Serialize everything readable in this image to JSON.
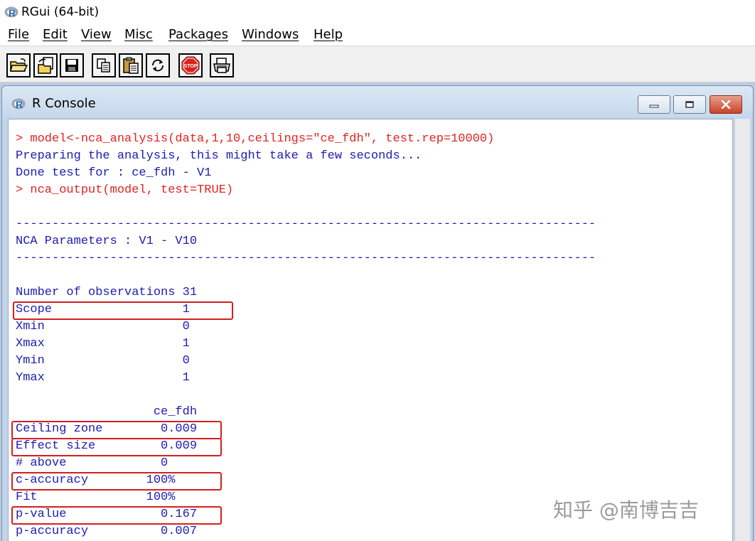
{
  "app": {
    "title": "RGui (64-bit)"
  },
  "menu": [
    {
      "label": "File"
    },
    {
      "label": "Edit"
    },
    {
      "label": "View"
    },
    {
      "label": "Misc"
    },
    {
      "label": "Packages"
    },
    {
      "label": "Windows"
    },
    {
      "label": "Help"
    }
  ],
  "toolbar": {
    "buttons": [
      {
        "icon": "open-folder-icon"
      },
      {
        "icon": "load-workspace-icon"
      },
      {
        "icon": "save-icon"
      },
      {
        "icon": "copy-icon"
      },
      {
        "icon": "paste-icon"
      },
      {
        "icon": "refresh-icon"
      },
      {
        "icon": "stop-icon",
        "label": "STOP",
        "color": "#d8241c"
      },
      {
        "icon": "print-icon"
      }
    ]
  },
  "console": {
    "title": "R Console",
    "lines": [
      {
        "text": "> model<-nca_analysis(data,1,10,ceilings=\"ce_fdh\", test.rep=10000)",
        "kind": "input"
      },
      {
        "text": "Preparing the analysis, this might take a few seconds...",
        "kind": "output"
      },
      {
        "text": "Done test for : ce_fdh - V1",
        "kind": "output"
      },
      {
        "text": "> nca_output(model, test=TRUE)",
        "kind": "input"
      },
      {
        "text": "",
        "kind": "output"
      },
      {
        "text": "--------------------------------------------------------------------------------",
        "kind": "output"
      },
      {
        "text": "NCA Parameters : V1 - V10",
        "kind": "output"
      },
      {
        "text": "--------------------------------------------------------------------------------",
        "kind": "output"
      },
      {
        "text": "",
        "kind": "output"
      },
      {
        "text": "Number of observations 31",
        "kind": "output"
      },
      {
        "text": "Scope                  1",
        "kind": "output"
      },
      {
        "text": "Xmin                   0",
        "kind": "output"
      },
      {
        "text": "Xmax                   1",
        "kind": "output"
      },
      {
        "text": "Ymin                   0",
        "kind": "output"
      },
      {
        "text": "Ymax                   1",
        "kind": "output"
      },
      {
        "text": "",
        "kind": "output"
      },
      {
        "text": "                   ce_fdh",
        "kind": "output"
      },
      {
        "text": "Ceiling zone        0.009",
        "kind": "output"
      },
      {
        "text": "Effect size         0.009",
        "kind": "output"
      },
      {
        "text": "# above             0",
        "kind": "output"
      },
      {
        "text": "c-accuracy        100%",
        "kind": "output"
      },
      {
        "text": "Fit               100%",
        "kind": "output"
      },
      {
        "text": "p-value             0.167",
        "kind": "output"
      },
      {
        "text": "p-accuracy          0.007",
        "kind": "output"
      }
    ]
  },
  "watermark": "知乎 @南博吉吉",
  "colors": {
    "input": "#e1241f",
    "output": "#1c1cb4",
    "highlight": "#d41f1f",
    "mdi_background": "#b9cde3"
  }
}
